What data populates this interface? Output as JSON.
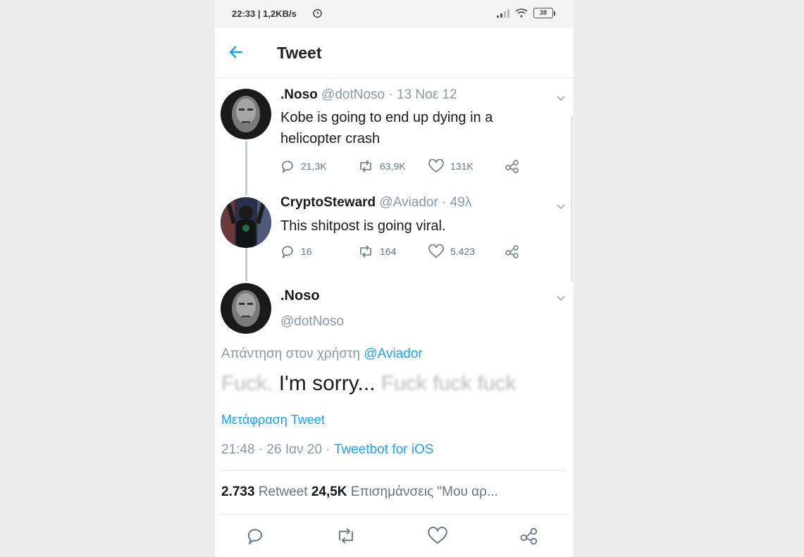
{
  "status_bar": {
    "text": "22:33 | 1,2KB/s",
    "icons": [
      "alarm-icon",
      "signal-icon",
      "wifi-icon",
      "battery-icon"
    ],
    "battery_label": "38"
  },
  "header": {
    "title": "Tweet",
    "back_icon": "arrow-left-icon"
  },
  "tweets": [
    {
      "name": ".Noso",
      "meta": " @dotNoso · 13 Νοε 12",
      "text": "Kobe is going to end up dying in a helicopter crash",
      "reply_count": "21,3K",
      "retweet_count": "63,9K",
      "like_count": "131K"
    },
    {
      "name": "CryptoSteward",
      "meta": " @Aviador · 49λ",
      "text": "This shitpost is going viral.",
      "reply_count": "16",
      "retweet_count": "164",
      "like_count": "5.423"
    }
  ],
  "main_tweet": {
    "name": ".Noso",
    "handle": "@dotNoso",
    "reply_prefix": "Απάντηση στον χρήστη ",
    "reply_mention": "@Aviador",
    "text_part1": "Fuck. ",
    "text_part2": "I'm sorry...",
    "text_part3": " Fuck fuck fuck",
    "translate_label": "Μετάφραση Tweet",
    "timestamp": "21:48 · 26 Ιαν 20 · ",
    "client": "Tweetbot for iOS",
    "retweet_count": "2.733",
    "retweet_label": " Retweet  ",
    "likes_count": "24,5K",
    "likes_label": " Επισημάνσεις \"Μου αρ..."
  },
  "colors": {
    "accent": "#1da1f2",
    "muted": "#8a98a5",
    "text": "#14171a",
    "thread_line": "#c4cfd6"
  }
}
